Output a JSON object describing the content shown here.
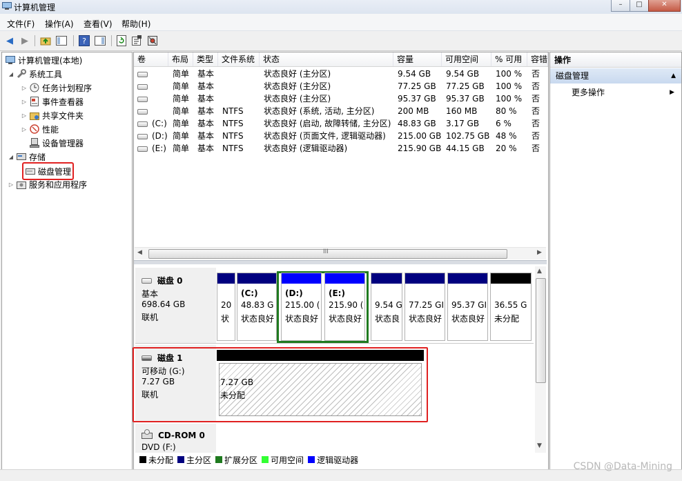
{
  "window": {
    "title": "计算机管理"
  },
  "menu": [
    "文件(F)",
    "操作(A)",
    "查看(V)",
    "帮助(H)"
  ],
  "tree": {
    "root": "计算机管理(本地)",
    "system_tools": "系统工具",
    "task_scheduler": "任务计划程序",
    "event_viewer": "事件查看器",
    "shared_folders": "共享文件夹",
    "performance": "性能",
    "device_manager": "设备管理器",
    "storage": "存储",
    "disk_management": "磁盘管理",
    "services_apps": "服务和应用程序"
  },
  "volume_table": {
    "columns": [
      "卷",
      "布局",
      "类型",
      "文件系统",
      "状态",
      "容量",
      "可用空间",
      "% 可用",
      "容错"
    ],
    "rows": [
      {
        "volume": "",
        "layout": "简单",
        "type": "基本",
        "fs": "",
        "status": "状态良好 (主分区)",
        "capacity": "9.54 GB",
        "free": "9.54 GB",
        "pct": "100 %",
        "ft": "否"
      },
      {
        "volume": "",
        "layout": "简单",
        "type": "基本",
        "fs": "",
        "status": "状态良好 (主分区)",
        "capacity": "77.25 GB",
        "free": "77.25 GB",
        "pct": "100 %",
        "ft": "否"
      },
      {
        "volume": "",
        "layout": "简单",
        "type": "基本",
        "fs": "",
        "status": "状态良好 (主分区)",
        "capacity": "95.37 GB",
        "free": "95.37 GB",
        "pct": "100 %",
        "ft": "否"
      },
      {
        "volume": "",
        "layout": "简单",
        "type": "基本",
        "fs": "NTFS",
        "status": "状态良好 (系统, 活动, 主分区)",
        "capacity": "200 MB",
        "free": "160 MB",
        "pct": "80 %",
        "ft": "否"
      },
      {
        "volume": "(C:)",
        "layout": "简单",
        "type": "基本",
        "fs": "NTFS",
        "status": "状态良好 (启动, 故障转储, 主分区)",
        "capacity": "48.83 GB",
        "free": "3.17 GB",
        "pct": "6 %",
        "ft": "否"
      },
      {
        "volume": "(D:)",
        "layout": "简单",
        "type": "基本",
        "fs": "NTFS",
        "status": "状态良好 (页面文件, 逻辑驱动器)",
        "capacity": "215.00 GB",
        "free": "102.75 GB",
        "pct": "48 %",
        "ft": "否"
      },
      {
        "volume": "(E:)",
        "layout": "简单",
        "type": "基本",
        "fs": "NTFS",
        "status": "状态良好 (逻辑驱动器)",
        "capacity": "215.90 GB",
        "free": "44.15 GB",
        "pct": "20 %",
        "ft": "否"
      }
    ]
  },
  "hscroll_glyph": "III",
  "disk0": {
    "name": "磁盘 0",
    "type": "基本",
    "size": "698.64 GB",
    "state": "联机",
    "partitions": [
      {
        "label": "",
        "line1": "20",
        "line2": "状"
      },
      {
        "label": "(C:)",
        "line1": "48.83 G",
        "line2": "状态良好"
      },
      {
        "label": "(D:)",
        "line1": "215.00 (",
        "line2": "状态良好"
      },
      {
        "label": "(E:)",
        "line1": "215.90 (",
        "line2": "状态良好"
      },
      {
        "label": "",
        "line1": "9.54 G",
        "line2": "状态良"
      },
      {
        "label": "",
        "line1": "77.25 GI",
        "line2": "状态良好"
      },
      {
        "label": "",
        "line1": "95.37 GI",
        "line2": "状态良好"
      },
      {
        "label": "",
        "line1": "36.55 G",
        "line2": "未分配"
      }
    ]
  },
  "disk1": {
    "name": "磁盘 1",
    "type": "可移动 (G:)",
    "size": "7.27 GB",
    "state": "联机",
    "partition": {
      "line1": "7.27 GB",
      "line2": "未分配"
    }
  },
  "cdrom": {
    "name": "CD-ROM 0",
    "type": "DVD (F:)"
  },
  "legend": [
    {
      "label": "未分配",
      "color": "#000000"
    },
    {
      "label": "主分区",
      "color": "#00007f"
    },
    {
      "label": "扩展分区",
      "color": "#1f7a1f"
    },
    {
      "label": "可用空间",
      "color": "#33ff33"
    },
    {
      "label": "逻辑驱动器",
      "color": "#0000ff"
    }
  ],
  "actions": {
    "header": "操作",
    "section": "磁盘管理",
    "more": "更多操作"
  },
  "watermark": "CSDN @Data-Mining"
}
